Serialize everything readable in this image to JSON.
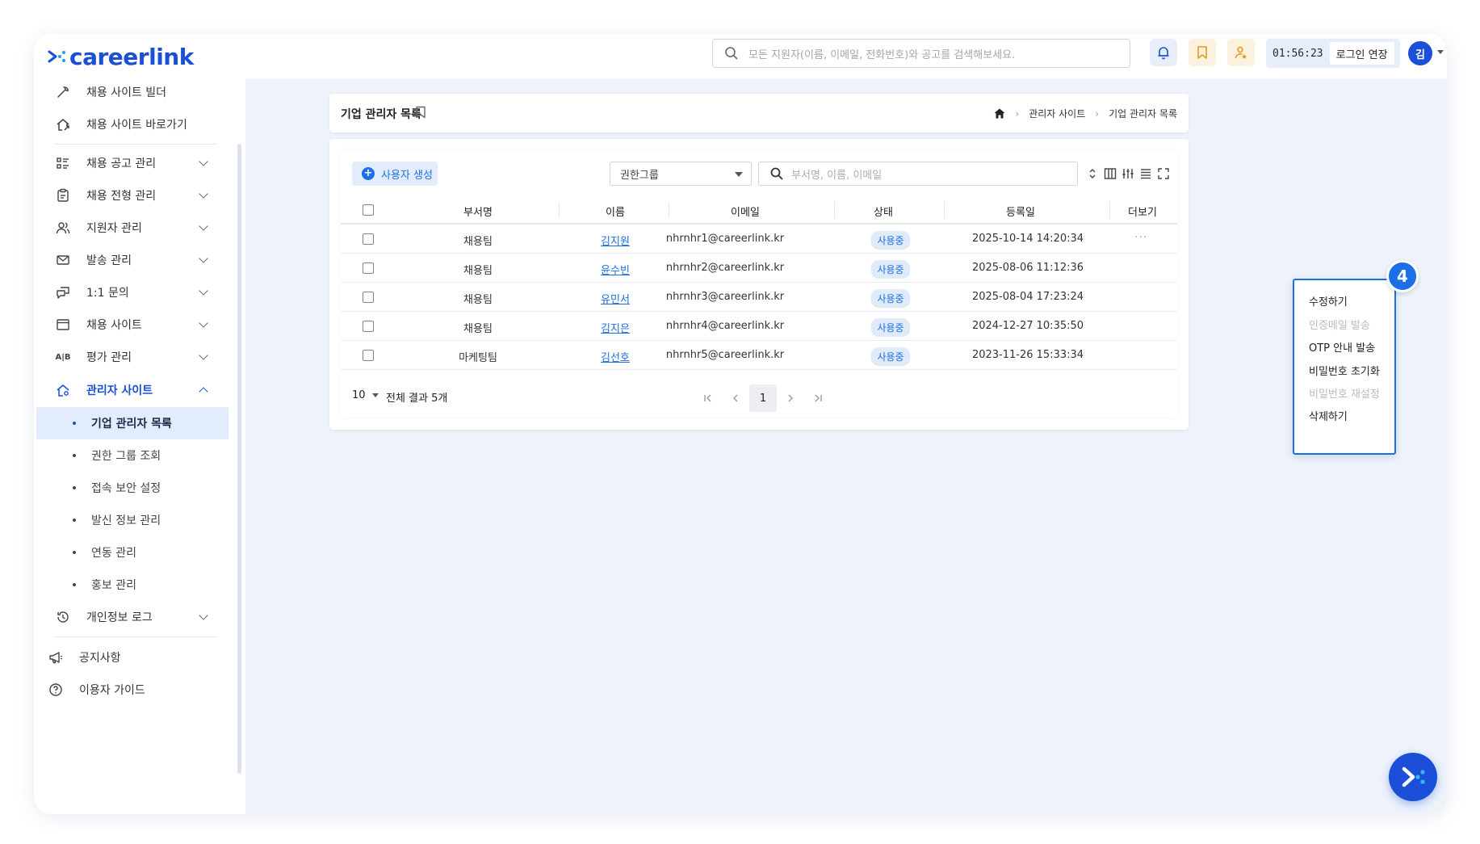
{
  "header": {
    "logo_text": "careerlink",
    "search_placeholder": "모든 지원자(이름, 이메일, 전화번호)와 공고를 검색해보세요.",
    "session_time": "01:56:23",
    "extend_login_label": "로그인 연장",
    "avatar_initial": "김"
  },
  "sidebar": {
    "top_items": [
      {
        "label": "채용 사이트 빌더",
        "icon": "wrench-icon"
      },
      {
        "label": "채용 사이트 바로가기",
        "icon": "home-link-icon"
      }
    ],
    "menu_items": [
      {
        "label": "채용 공고 관리",
        "icon": "list-icon"
      },
      {
        "label": "채용 전형 관리",
        "icon": "clipboard-icon"
      },
      {
        "label": "지원자 관리",
        "icon": "users-icon"
      },
      {
        "label": "발송 관리",
        "icon": "mail-icon"
      },
      {
        "label": "1:1 문의",
        "icon": "chat-icon"
      },
      {
        "label": "채용 사이트",
        "icon": "browser-icon"
      },
      {
        "label": "평가 관리",
        "icon": "ab-icon"
      },
      {
        "label": "관리자 사이트",
        "icon": "admin-home-icon"
      }
    ],
    "sub_items": [
      {
        "label": "기업 관리자 목록"
      },
      {
        "label": "권한 그룹 조회"
      },
      {
        "label": "접속 보안 설정"
      },
      {
        "label": "발신 정보 관리"
      },
      {
        "label": "연동 관리"
      },
      {
        "label": "홍보 관리"
      }
    ],
    "log_item": {
      "label": "개인정보 로그",
      "icon": "history-icon"
    },
    "bottom_items": [
      {
        "label": "공지사항",
        "icon": "megaphone-icon"
      },
      {
        "label": "이용자 가이드",
        "icon": "help-icon"
      }
    ]
  },
  "page": {
    "title": "기업 관리자 목록",
    "breadcrumb": [
      "관리자 사이트",
      "기업 관리자 목록"
    ]
  },
  "toolbar": {
    "create_label": "사용자 생성",
    "group_select_value": "권한그룹",
    "search_placeholder": "부서명, 이름, 이메일"
  },
  "table": {
    "columns": [
      "부서명",
      "이름",
      "이메일",
      "상태",
      "등록일",
      "더보기"
    ],
    "rows": [
      {
        "dept": "채용팀",
        "name": "김지원",
        "email": "nhrnhr1@careerlink.kr",
        "status": "사용중",
        "date": "2025-10-14 14:20:34"
      },
      {
        "dept": "채용팀",
        "name": "윤수빈",
        "email": "nhrnhr2@careerlink.kr",
        "status": "사용중",
        "date": "2025-08-06 11:12:36"
      },
      {
        "dept": "채용팀",
        "name": "유민서",
        "email": "nhrnhr3@careerlink.kr",
        "status": "사용중",
        "date": "2025-08-04 17:23:24"
      },
      {
        "dept": "채용팀",
        "name": "김지은",
        "email": "nhrnhr4@careerlink.kr",
        "status": "사용중",
        "date": "2024-12-27 10:35:50"
      },
      {
        "dept": "마케팅팀",
        "name": "김선호",
        "email": "nhrnhr5@careerlink.kr",
        "status": "사용중",
        "date": "2023-11-26 15:33:34"
      }
    ],
    "more_glyph": "···"
  },
  "footer": {
    "page_size": "10",
    "total_text": "전체 결과 5개",
    "current_page": "1"
  },
  "context_menu": {
    "items": [
      {
        "label": "수정하기",
        "enabled": true
      },
      {
        "label": "인증메일 발송",
        "enabled": false
      },
      {
        "label": "OTP 안내 발송",
        "enabled": true
      },
      {
        "label": "비밀번호 초기화",
        "enabled": true
      },
      {
        "label": "비밀번호 재설정",
        "enabled": false
      },
      {
        "label": "삭제하기",
        "enabled": true
      }
    ],
    "step_badge": "4"
  },
  "colors": {
    "brand": "#1c4fd8",
    "accent": "#1c6fe6",
    "main_bg": "#edf2fb"
  }
}
